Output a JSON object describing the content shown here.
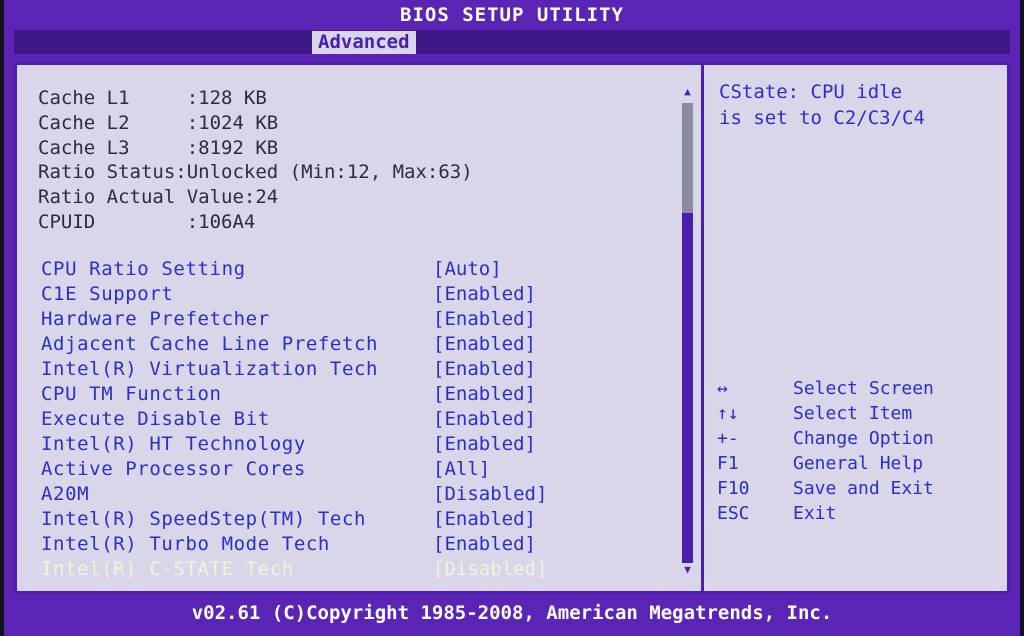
{
  "title": "BIOS SETUP UTILITY",
  "tab": "Advanced",
  "info": [
    "Cache L1     :128 KB",
    "Cache L2     :1024 KB",
    "Cache L3     :8192 KB",
    "Ratio Status:Unlocked (Min:12, Max:63)",
    "Ratio Actual Value:24",
    "CPUID        :106A4"
  ],
  "options": [
    {
      "label": "CPU Ratio Setting",
      "value": "[Auto]"
    },
    {
      "label": "C1E Support",
      "value": "[Enabled]"
    },
    {
      "label": "Hardware Prefetcher",
      "value": "[Enabled]"
    },
    {
      "label": "Adjacent Cache Line Prefetch",
      "value": "[Enabled]"
    },
    {
      "label": "Intel(R) Virtualization Tech",
      "value": "[Enabled]"
    },
    {
      "label": "CPU TM Function",
      "value": "[Enabled]"
    },
    {
      "label": "Execute Disable Bit",
      "value": "[Enabled]"
    },
    {
      "label": "Intel(R) HT Technology",
      "value": "[Enabled]"
    },
    {
      "label": "Active Processor Cores",
      "value": "[All]"
    },
    {
      "label": "A20M",
      "value": "[Disabled]"
    },
    {
      "label": "Intel(R) SpeedStep(TM) Tech",
      "value": "[Enabled]"
    },
    {
      "label": "Intel(R) Turbo Mode Tech",
      "value": "[Enabled]"
    },
    {
      "label": "Intel(R) C-STATE Tech",
      "value": "[Disabled]"
    }
  ],
  "selected_option": "Intel(R) C-STATE Tech",
  "help": "CState: CPU idle\nis set to C2/C3/C4",
  "keys": [
    {
      "key": "↔",
      "desc": "Select Screen"
    },
    {
      "key": "↑↓",
      "desc": "Select Item"
    },
    {
      "key": "+-",
      "desc": "Change Option"
    },
    {
      "key": "F1",
      "desc": "General Help"
    },
    {
      "key": "F10",
      "desc": "Save and Exit"
    },
    {
      "key": "ESC",
      "desc": "Exit"
    }
  ],
  "footer": "v02.61 (C)Copyright 1985-2008, American Megatrends, Inc.",
  "colors": {
    "frame": "#5a25b4",
    "panel": "#d8d6e8",
    "item": "#2a2fc8",
    "selected": "#f6f2d8"
  }
}
